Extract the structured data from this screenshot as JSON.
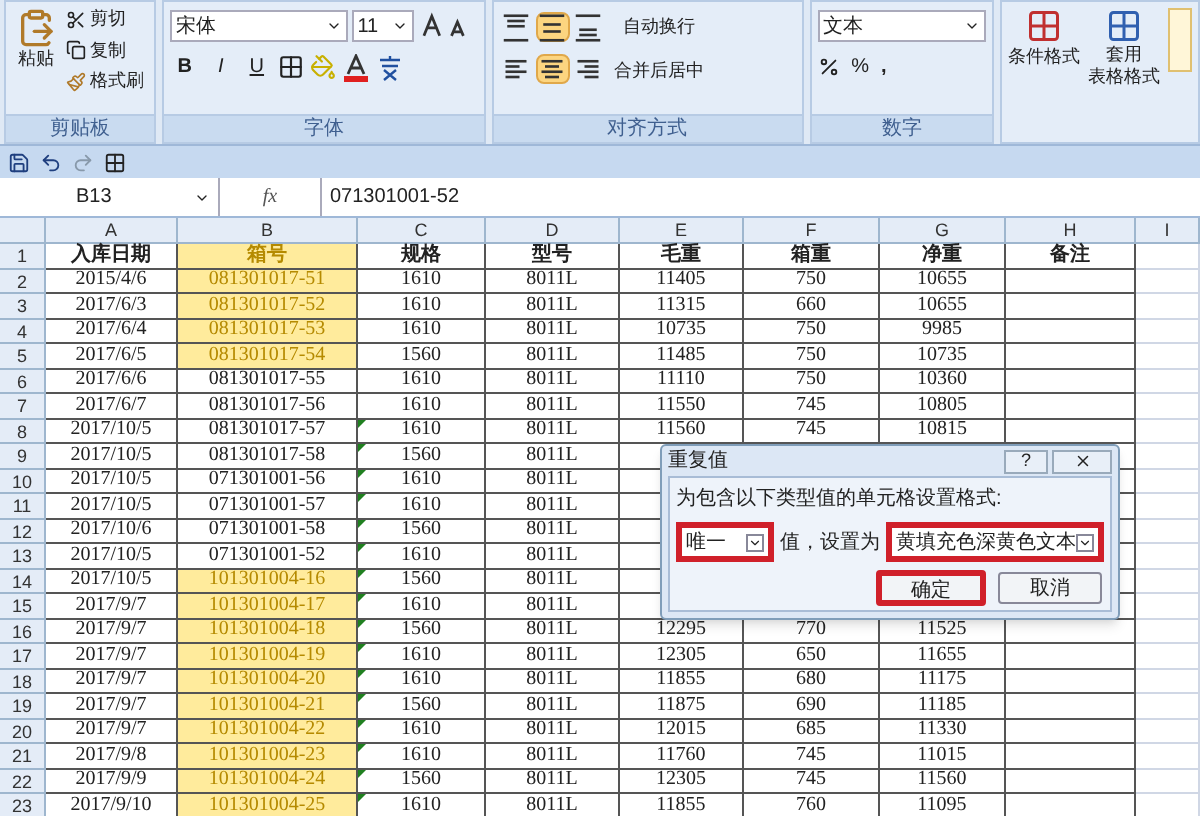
{
  "clipboard": {
    "paste": "粘贴",
    "cut": "剪切",
    "copy": "复制",
    "painter": "格式刷",
    "label": "剪贴板"
  },
  "font": {
    "name": "宋体",
    "size": "11",
    "bold": "B",
    "italic": "I",
    "underline": "U",
    "label": "字体"
  },
  "alignment": {
    "vertical": [
      {
        "kind": "top",
        "selected": false
      },
      {
        "kind": "middle",
        "selected": true
      },
      {
        "kind": "bottom",
        "selected": false
      }
    ],
    "horizontal": [
      {
        "kind": "left",
        "selected": false
      },
      {
        "kind": "center",
        "selected": true
      },
      {
        "kind": "right",
        "selected": false
      }
    ],
    "wrap": "自动换行",
    "merge": "合并后居中",
    "label": "对齐方式"
  },
  "number": {
    "format": "文本",
    "percent": "%",
    "comma": ",",
    "label": "数字"
  },
  "styles": {
    "conditional": "条件格式",
    "table_format": [
      "套用",
      "表格格式"
    ]
  },
  "formula_bar": {
    "name_box": "B13",
    "fx": "fx",
    "value": "071301001-52"
  },
  "columns": [
    "A",
    "B",
    "C",
    "D",
    "E",
    "F",
    "G",
    "H",
    "I"
  ],
  "rows": [
    {
      "number": "1",
      "kind": "header",
      "duplicate": true,
      "flag": false,
      "cells": [
        "入库日期",
        "箱号",
        "规格",
        "型号",
        "毛重",
        "箱重",
        "净重",
        "备注"
      ]
    },
    {
      "number": "2",
      "kind": "data",
      "duplicate": true,
      "flag": false,
      "cells": [
        "2015/4/6",
        "081301017-51",
        "1610",
        "8011L",
        "11405",
        "750",
        "10655"
      ]
    },
    {
      "number": "3",
      "kind": "data",
      "duplicate": true,
      "flag": false,
      "cells": [
        "2017/6/3",
        "081301017-52",
        "1610",
        "8011L",
        "11315",
        "660",
        "10655"
      ]
    },
    {
      "number": "4",
      "kind": "data",
      "duplicate": true,
      "flag": false,
      "cells": [
        "2017/6/4",
        "081301017-53",
        "1610",
        "8011L",
        "10735",
        "750",
        "9985"
      ]
    },
    {
      "number": "5",
      "kind": "data",
      "duplicate": true,
      "flag": false,
      "cells": [
        "2017/6/5",
        "081301017-54",
        "1560",
        "8011L",
        "11485",
        "750",
        "10735"
      ]
    },
    {
      "number": "6",
      "kind": "data",
      "duplicate": false,
      "flag": false,
      "cells": [
        "2017/6/6",
        "081301017-55",
        "1610",
        "8011L",
        "11110",
        "750",
        "10360"
      ]
    },
    {
      "number": "7",
      "kind": "data",
      "duplicate": false,
      "flag": false,
      "cells": [
        "2017/6/7",
        "081301017-56",
        "1610",
        "8011L",
        "11550",
        "745",
        "10805"
      ]
    },
    {
      "number": "8",
      "kind": "data",
      "duplicate": false,
      "flag": true,
      "cells": [
        "2017/10/5",
        "081301017-57",
        "1610",
        "8011L",
        "11560",
        "745",
        "10815"
      ]
    },
    {
      "number": "9",
      "kind": "data",
      "duplicate": false,
      "flag": true,
      "cells": [
        "2017/10/5",
        "081301017-58",
        "1560",
        "8011L"
      ]
    },
    {
      "number": "10",
      "kind": "data",
      "duplicate": false,
      "flag": true,
      "cells": [
        "2017/10/5",
        "071301001-56",
        "1610",
        "8011L"
      ]
    },
    {
      "number": "11",
      "kind": "data",
      "duplicate": false,
      "flag": true,
      "cells": [
        "2017/10/5",
        "071301001-57",
        "1610",
        "8011L"
      ]
    },
    {
      "number": "12",
      "kind": "data",
      "duplicate": false,
      "flag": true,
      "cells": [
        "2017/10/6",
        "071301001-58",
        "1560",
        "8011L"
      ]
    },
    {
      "number": "13",
      "kind": "data",
      "duplicate": false,
      "flag": true,
      "cells": [
        "2017/10/5",
        "071301001-52",
        "1610",
        "8011L"
      ]
    },
    {
      "number": "14",
      "kind": "data",
      "duplicate": true,
      "flag": true,
      "cells": [
        "2017/10/5",
        "101301004-16",
        "1560",
        "8011L"
      ]
    },
    {
      "number": "15",
      "kind": "data",
      "duplicate": true,
      "flag": true,
      "cells": [
        "2017/9/7",
        "101301004-17",
        "1610",
        "8011L"
      ]
    },
    {
      "number": "16",
      "kind": "data",
      "duplicate": true,
      "flag": true,
      "cells": [
        "2017/9/7",
        "101301004-18",
        "1560",
        "8011L",
        "12295",
        "770",
        "11525"
      ]
    },
    {
      "number": "17",
      "kind": "data",
      "duplicate": true,
      "flag": true,
      "cells": [
        "2017/9/7",
        "101301004-19",
        "1610",
        "8011L",
        "12305",
        "650",
        "11655"
      ]
    },
    {
      "number": "18",
      "kind": "data",
      "duplicate": true,
      "flag": true,
      "cells": [
        "2017/9/7",
        "101301004-20",
        "1610",
        "8011L",
        "11855",
        "680",
        "11175"
      ]
    },
    {
      "number": "19",
      "kind": "data",
      "duplicate": true,
      "flag": true,
      "cells": [
        "2017/9/7",
        "101301004-21",
        "1560",
        "8011L",
        "11875",
        "690",
        "11185"
      ]
    },
    {
      "number": "20",
      "kind": "data",
      "duplicate": true,
      "flag": true,
      "cells": [
        "2017/9/7",
        "101301004-22",
        "1610",
        "8011L",
        "12015",
        "685",
        "11330"
      ]
    },
    {
      "number": "21",
      "kind": "data",
      "duplicate": true,
      "flag": true,
      "cells": [
        "2017/9/8",
        "101301004-23",
        "1610",
        "8011L",
        "11760",
        "745",
        "11015"
      ]
    },
    {
      "number": "22",
      "kind": "data",
      "duplicate": true,
      "flag": true,
      "cells": [
        "2017/9/9",
        "101301004-24",
        "1560",
        "8011L",
        "12305",
        "745",
        "11560"
      ]
    },
    {
      "number": "23",
      "kind": "data",
      "duplicate": true,
      "flag": true,
      "cells": [
        "2017/9/10",
        "101301004-25",
        "1610",
        "8011L",
        "11855",
        "760",
        "11095"
      ]
    }
  ],
  "dialog": {
    "title": "重复值",
    "help": "?",
    "prompt": "为包含以下类型值的单元格设置格式:",
    "rule": {
      "value": "唯一",
      "marked": true
    },
    "between": "值，设置为",
    "format": {
      "value": "黄填充色深黄色文本",
      "marked": true
    },
    "ok": {
      "label": "确定",
      "marked": true
    },
    "cancel": {
      "label": "取消",
      "marked": false
    }
  }
}
